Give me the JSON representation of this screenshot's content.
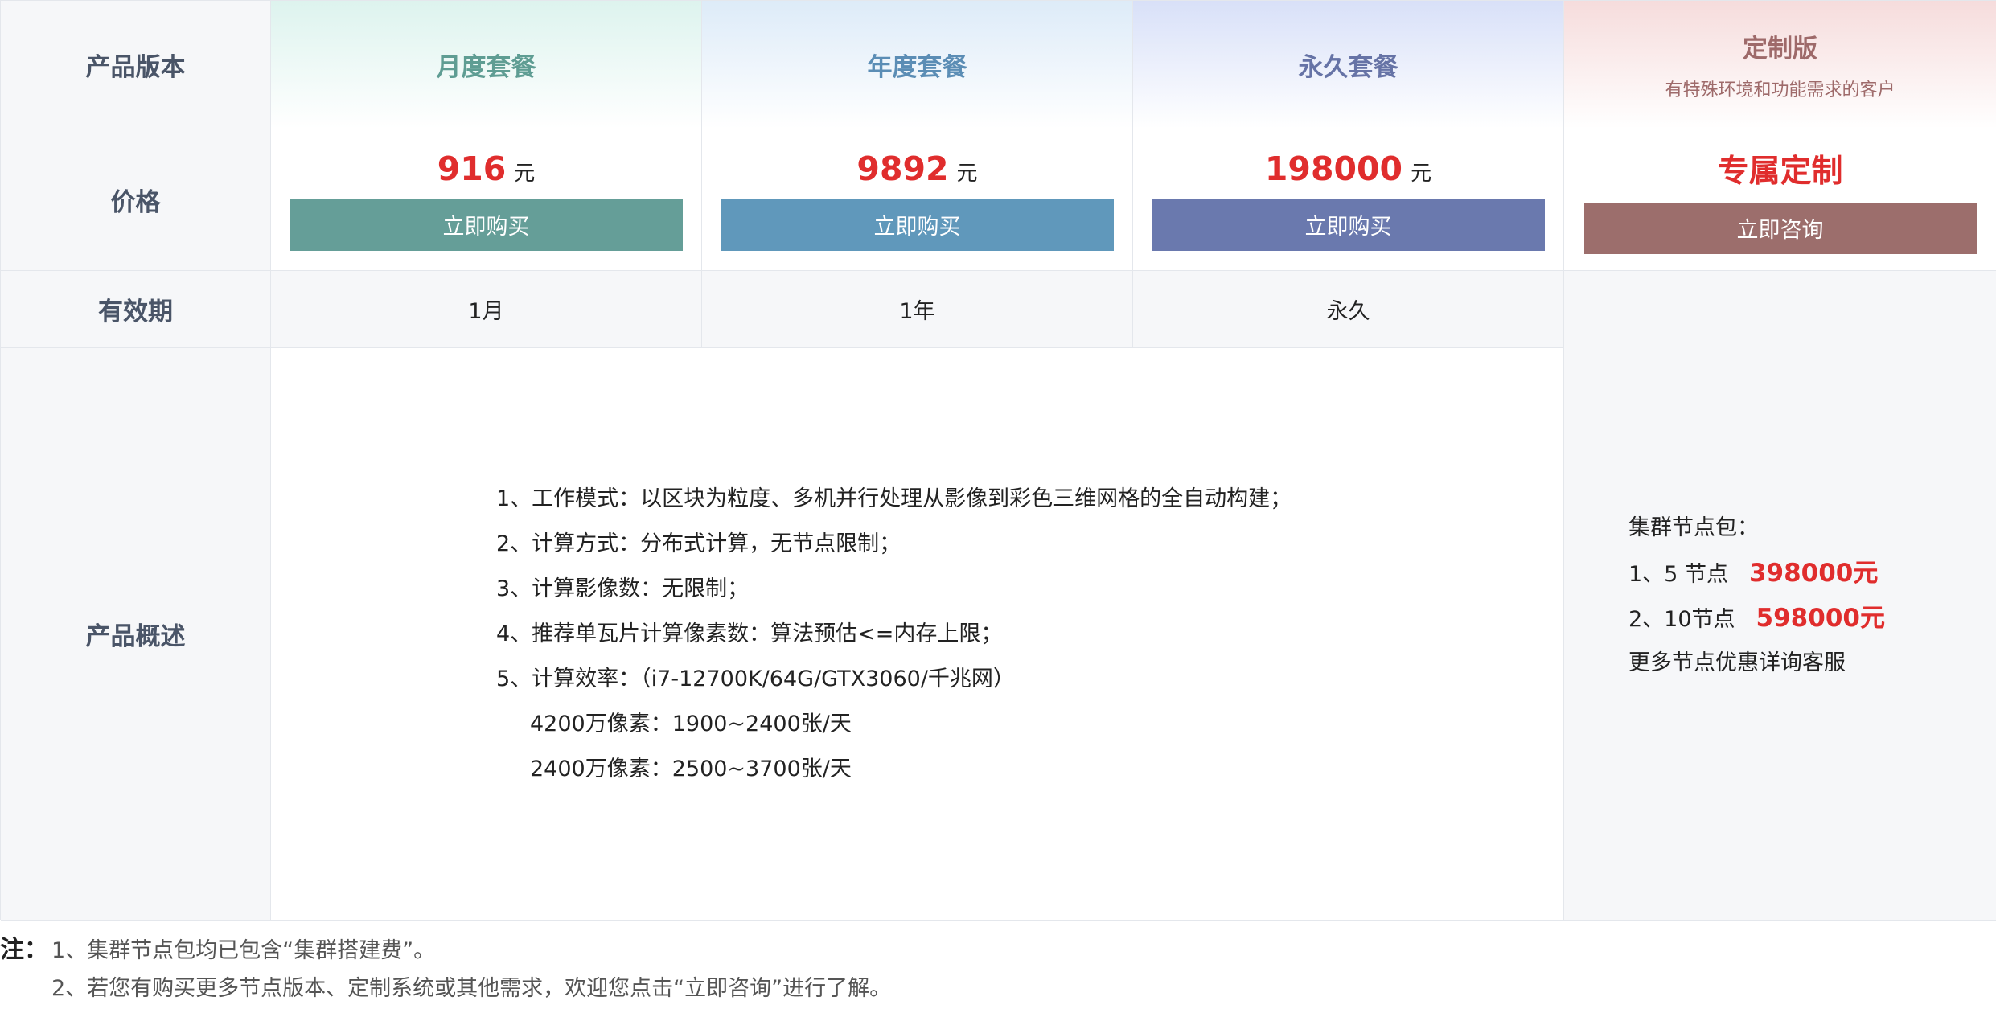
{
  "table": {
    "row_labels": {
      "version": "产品版本",
      "price": "价格",
      "validity": "有效期",
      "summary": "产品概述"
    },
    "plans": [
      {
        "name": "月度套餐",
        "price": "916",
        "unit": "元",
        "button": "立即购买",
        "validity": "1月",
        "color": "#659e98"
      },
      {
        "name": "年度套餐",
        "price": "9892",
        "unit": "元",
        "button": "立即购买",
        "validity": "1年",
        "color": "#6098bb"
      },
      {
        "name": "永久套餐",
        "price": "198000",
        "unit": "元",
        "button": "立即购买",
        "validity": "永久",
        "color": "#6a79ae"
      }
    ],
    "custom": {
      "name": "定制版",
      "description": "有特殊环境和功能需求的客户",
      "price_text": "专属定制",
      "button": "立即咨询",
      "color": "#9c6e6c",
      "package_title": "集群节点包：",
      "packages": [
        {
          "label": "1、5  节点",
          "price": "398000元"
        },
        {
          "label": "2、10节点",
          "price": "598000元"
        }
      ],
      "more": "更多节点优惠详询客服"
    },
    "summary_lines": [
      "1、工作模式：以区块为粒度、多机并行处理从影像到彩色三维网格的全自动构建；",
      "2、计算方式：分布式计算，无节点限制；",
      "3、计算影像数：无限制；",
      "4、推荐单瓦片计算像素数：算法预估<=内存上限；",
      "5、计算效率：（i7-12700K/64G/GTX3060/千兆网）",
      "4200万像素：1900~2400张/天",
      "2400万像素：2500~3700张/天"
    ]
  },
  "notes": {
    "label": "注：",
    "lines": [
      "1、集群节点包均已包含“集群搭建费”。",
      "2、若您有购买更多节点版本、定制系统或其他需求，欢迎您点击“立即咨询”进行了解。"
    ]
  },
  "colors": {
    "price_red": "#e02d2d",
    "header_bg": "#f6f7f9",
    "border": "#e4e7ec"
  }
}
